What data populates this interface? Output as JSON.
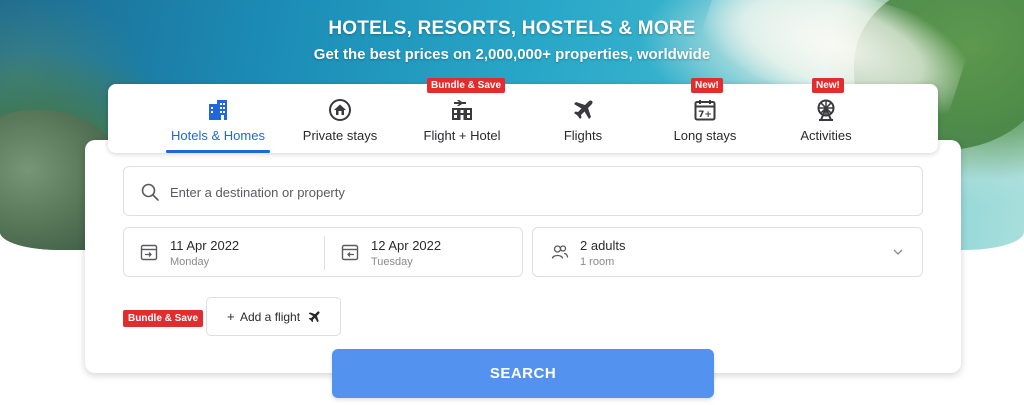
{
  "hero": {
    "title": "HOTELS, RESORTS, HOSTELS & MORE",
    "subtitle": "Get the best prices on 2,000,000+ properties, worldwide"
  },
  "tabs": [
    {
      "label": "Hotels & Homes",
      "icon": "hotel-building-icon",
      "active": true,
      "badge": ""
    },
    {
      "label": "Private stays",
      "icon": "house-icon",
      "active": false,
      "badge": ""
    },
    {
      "label": "Flight + Hotel",
      "icon": "flight-hotel-icon",
      "active": false,
      "badge": "Bundle & Save"
    },
    {
      "label": "Flights",
      "icon": "airplane-icon",
      "active": false,
      "badge": ""
    },
    {
      "label": "Long stays",
      "icon": "calendar-seven-icon",
      "active": false,
      "badge": "New!"
    },
    {
      "label": "Activities",
      "icon": "ferris-wheel-icon",
      "active": false,
      "badge": "New!"
    }
  ],
  "search": {
    "placeholder": "Enter a destination or property"
  },
  "dates": {
    "checkin": {
      "date": "11 Apr 2022",
      "day": "Monday"
    },
    "checkout": {
      "date": "12 Apr 2022",
      "day": "Tuesday"
    }
  },
  "guests": {
    "adults": "2 adults",
    "rooms": "1 room"
  },
  "bundle": {
    "badge": "Bundle & Save",
    "add_flight_plus": "+",
    "add_flight_label": "Add a flight"
  },
  "search_button": "SEARCH",
  "colors": {
    "accent": "#2067da",
    "button": "#5492f0",
    "badge": "#e12d2d"
  }
}
